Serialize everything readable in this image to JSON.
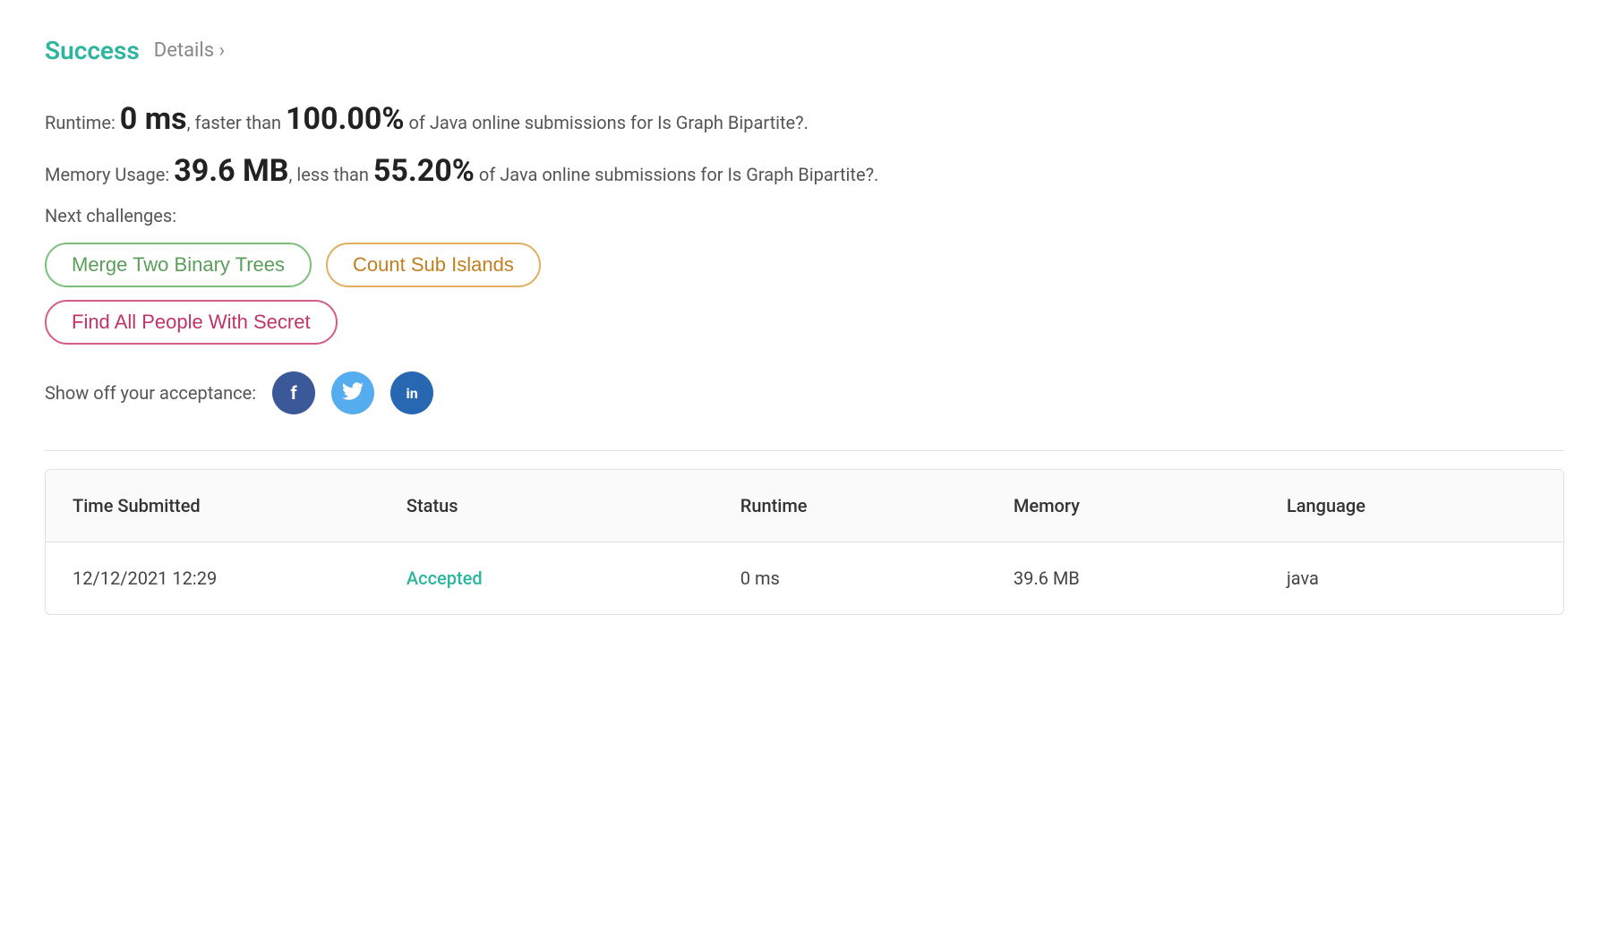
{
  "header": {
    "success_label": "Success",
    "details_label": "Details ›"
  },
  "runtime_stat": {
    "prefix": "Runtime: ",
    "value": "0 ms",
    "connector": ", faster than ",
    "percent": "100.00%",
    "suffix": " of Java online submissions for Is Graph Bipartite?."
  },
  "memory_stat": {
    "prefix": "Memory Usage: ",
    "value": "39.6 MB",
    "connector": ", less than ",
    "percent": "55.20%",
    "suffix": " of Java online submissions for Is Graph Bipartite?."
  },
  "next_challenges": {
    "label": "Next challenges:",
    "challenges": [
      {
        "id": "merge-two-binary-trees",
        "label": "Merge Two Binary Trees",
        "style": "green"
      },
      {
        "id": "count-sub-islands",
        "label": "Count Sub Islands",
        "style": "orange"
      },
      {
        "id": "find-all-people-with-secret",
        "label": "Find All People With Secret",
        "style": "pink"
      }
    ]
  },
  "social": {
    "label": "Show off your acceptance:",
    "facebook_letter": "f",
    "twitter_letter": "t",
    "linkedin_letter": "in"
  },
  "table": {
    "headers": {
      "time_submitted": "Time Submitted",
      "status": "Status",
      "runtime": "Runtime",
      "memory": "Memory",
      "language": "Language"
    },
    "rows": [
      {
        "time_submitted": "12/12/2021 12:29",
        "status": "Accepted",
        "runtime": "0 ms",
        "memory": "39.6 MB",
        "language": "java"
      }
    ]
  }
}
